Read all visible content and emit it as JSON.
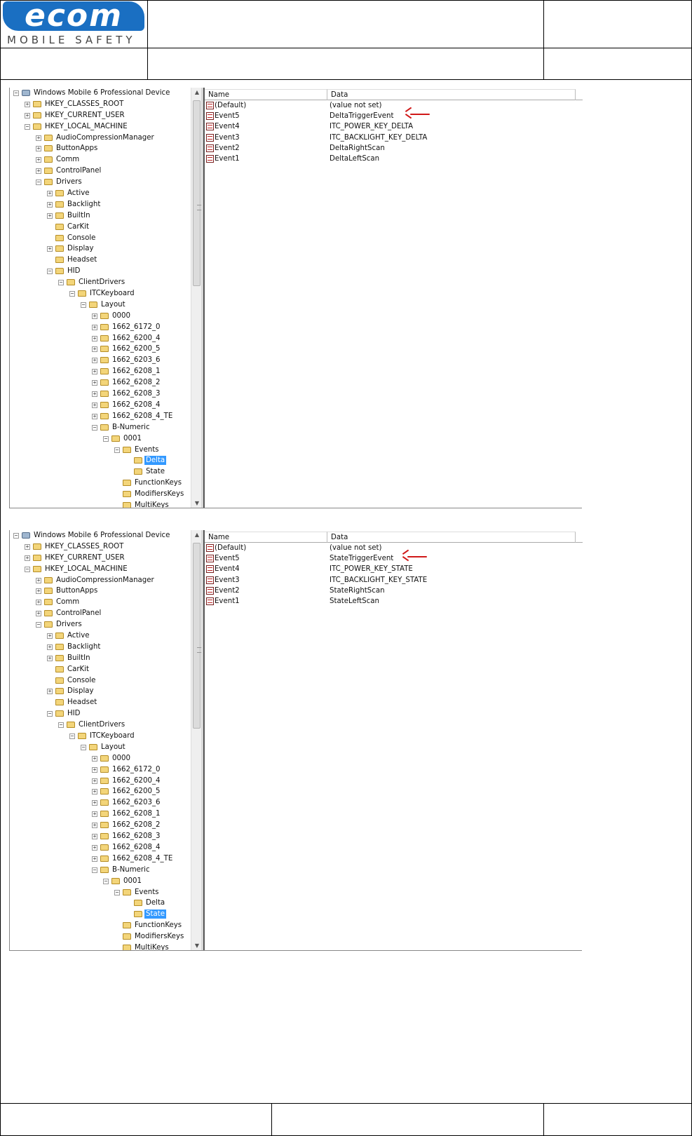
{
  "header": {
    "logo_text": "ecom",
    "logo_tagline": "MOBILE SAFETY",
    "brand_color": "#1a6fc2"
  },
  "screens": [
    {
      "tree": [
        {
          "label": "Windows Mobile 6 Professional Device",
          "level": 0,
          "toggle": "-",
          "icon": "computer"
        },
        {
          "label": "HKEY_CLASSES_ROOT",
          "level": 1,
          "toggle": "+"
        },
        {
          "label": "HKEY_CURRENT_USER",
          "level": 1,
          "toggle": "+"
        },
        {
          "label": "HKEY_LOCAL_MACHINE",
          "level": 1,
          "toggle": "-"
        },
        {
          "label": "AudioCompressionManager",
          "level": 2,
          "toggle": "+"
        },
        {
          "label": "ButtonApps",
          "level": 2,
          "toggle": "+"
        },
        {
          "label": "Comm",
          "level": 2,
          "toggle": "+"
        },
        {
          "label": "ControlPanel",
          "level": 2,
          "toggle": "+"
        },
        {
          "label": "Drivers",
          "level": 2,
          "toggle": "-"
        },
        {
          "label": "Active",
          "level": 3,
          "toggle": "+"
        },
        {
          "label": "Backlight",
          "level": 3,
          "toggle": "+"
        },
        {
          "label": "BuiltIn",
          "level": 3,
          "toggle": "+"
        },
        {
          "label": "CarKit",
          "level": 3,
          "toggle": ""
        },
        {
          "label": "Console",
          "level": 3,
          "toggle": ""
        },
        {
          "label": "Display",
          "level": 3,
          "toggle": "+"
        },
        {
          "label": "Headset",
          "level": 3,
          "toggle": ""
        },
        {
          "label": "HID",
          "level": 3,
          "toggle": "-"
        },
        {
          "label": "ClientDrivers",
          "level": 4,
          "toggle": "-"
        },
        {
          "label": "ITCKeyboard",
          "level": 5,
          "toggle": "-"
        },
        {
          "label": "Layout",
          "level": 6,
          "toggle": "-"
        },
        {
          "label": "0000",
          "level": 7,
          "toggle": "+"
        },
        {
          "label": "1662_6172_0",
          "level": 7,
          "toggle": "+"
        },
        {
          "label": "1662_6200_4",
          "level": 7,
          "toggle": "+"
        },
        {
          "label": "1662_6200_5",
          "level": 7,
          "toggle": "+"
        },
        {
          "label": "1662_6203_6",
          "level": 7,
          "toggle": "+"
        },
        {
          "label": "1662_6208_1",
          "level": 7,
          "toggle": "+"
        },
        {
          "label": "1662_6208_2",
          "level": 7,
          "toggle": "+"
        },
        {
          "label": "1662_6208_3",
          "level": 7,
          "toggle": "+"
        },
        {
          "label": "1662_6208_4",
          "level": 7,
          "toggle": "+"
        },
        {
          "label": "1662_6208_4_TE",
          "level": 7,
          "toggle": "+"
        },
        {
          "label": "B-Numeric",
          "level": 7,
          "toggle": "-"
        },
        {
          "label": "0001",
          "level": 8,
          "toggle": "-"
        },
        {
          "label": "Events",
          "level": 9,
          "toggle": "-"
        },
        {
          "label": "Delta",
          "level": 10,
          "toggle": "",
          "selected": true
        },
        {
          "label": "State",
          "level": 10,
          "toggle": ""
        },
        {
          "label": "FunctionKeys",
          "level": 9,
          "toggle": ""
        },
        {
          "label": "ModifiersKeys",
          "level": 9,
          "toggle": ""
        },
        {
          "label": "MultiKeys",
          "level": 9,
          "toggle": ""
        }
      ],
      "columns": {
        "name": "Name",
        "data": "Data"
      },
      "values": [
        {
          "name": "(Default)",
          "data": "(value not set)"
        },
        {
          "name": "Event5",
          "data": "DeltaTriggerEvent"
        },
        {
          "name": "Event4",
          "data": "ITC_POWER_KEY_DELTA"
        },
        {
          "name": "Event3",
          "data": "ITC_BACKLIGHT_KEY_DELTA"
        },
        {
          "name": "Event2",
          "data": "DeltaRightScan"
        },
        {
          "name": "Event1",
          "data": "DeltaLeftScan"
        }
      ]
    },
    {
      "tree": [
        {
          "label": "Windows Mobile 6 Professional Device",
          "level": 0,
          "toggle": "-",
          "icon": "computer"
        },
        {
          "label": "HKEY_CLASSES_ROOT",
          "level": 1,
          "toggle": "+"
        },
        {
          "label": "HKEY_CURRENT_USER",
          "level": 1,
          "toggle": "+"
        },
        {
          "label": "HKEY_LOCAL_MACHINE",
          "level": 1,
          "toggle": "-"
        },
        {
          "label": "AudioCompressionManager",
          "level": 2,
          "toggle": "+"
        },
        {
          "label": "ButtonApps",
          "level": 2,
          "toggle": "+"
        },
        {
          "label": "Comm",
          "level": 2,
          "toggle": "+"
        },
        {
          "label": "ControlPanel",
          "level": 2,
          "toggle": "+"
        },
        {
          "label": "Drivers",
          "level": 2,
          "toggle": "-"
        },
        {
          "label": "Active",
          "level": 3,
          "toggle": "+"
        },
        {
          "label": "Backlight",
          "level": 3,
          "toggle": "+"
        },
        {
          "label": "BuiltIn",
          "level": 3,
          "toggle": "+"
        },
        {
          "label": "CarKit",
          "level": 3,
          "toggle": ""
        },
        {
          "label": "Console",
          "level": 3,
          "toggle": ""
        },
        {
          "label": "Display",
          "level": 3,
          "toggle": "+"
        },
        {
          "label": "Headset",
          "level": 3,
          "toggle": ""
        },
        {
          "label": "HID",
          "level": 3,
          "toggle": "-"
        },
        {
          "label": "ClientDrivers",
          "level": 4,
          "toggle": "-"
        },
        {
          "label": "ITCKeyboard",
          "level": 5,
          "toggle": "-"
        },
        {
          "label": "Layout",
          "level": 6,
          "toggle": "-"
        },
        {
          "label": "0000",
          "level": 7,
          "toggle": "+"
        },
        {
          "label": "1662_6172_0",
          "level": 7,
          "toggle": "+"
        },
        {
          "label": "1662_6200_4",
          "level": 7,
          "toggle": "+"
        },
        {
          "label": "1662_6200_5",
          "level": 7,
          "toggle": "+"
        },
        {
          "label": "1662_6203_6",
          "level": 7,
          "toggle": "+"
        },
        {
          "label": "1662_6208_1",
          "level": 7,
          "toggle": "+"
        },
        {
          "label": "1662_6208_2",
          "level": 7,
          "toggle": "+"
        },
        {
          "label": "1662_6208_3",
          "level": 7,
          "toggle": "+"
        },
        {
          "label": "1662_6208_4",
          "level": 7,
          "toggle": "+"
        },
        {
          "label": "1662_6208_4_TE",
          "level": 7,
          "toggle": "+"
        },
        {
          "label": "B-Numeric",
          "level": 7,
          "toggle": "-"
        },
        {
          "label": "0001",
          "level": 8,
          "toggle": "-"
        },
        {
          "label": "Events",
          "level": 9,
          "toggle": "-"
        },
        {
          "label": "Delta",
          "level": 10,
          "toggle": ""
        },
        {
          "label": "State",
          "level": 10,
          "toggle": "",
          "selected": true
        },
        {
          "label": "FunctionKeys",
          "level": 9,
          "toggle": ""
        },
        {
          "label": "ModifiersKeys",
          "level": 9,
          "toggle": ""
        },
        {
          "label": "MultiKeys",
          "level": 9,
          "toggle": ""
        }
      ],
      "columns": {
        "name": "Name",
        "data": "Data"
      },
      "values": [
        {
          "name": "(Default)",
          "data": "(value not set)"
        },
        {
          "name": "Event5",
          "data": "StateTriggerEvent"
        },
        {
          "name": "Event4",
          "data": "ITC_POWER_KEY_STATE"
        },
        {
          "name": "Event3",
          "data": "ITC_BACKLIGHT_KEY_STATE"
        },
        {
          "name": "Event2",
          "data": "StateRightScan"
        },
        {
          "name": "Event1",
          "data": "StateLeftScan"
        }
      ]
    }
  ],
  "colors": {
    "selection": "#3399ff",
    "annotation_arrow": "#d01818",
    "folder": "#f3d57a"
  }
}
